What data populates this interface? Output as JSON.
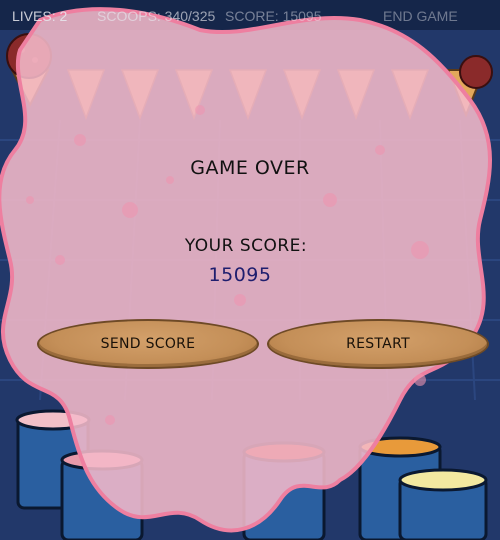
{
  "hud": {
    "lives": "LIVES: 2",
    "scoops": "SCOOPS: 340/325",
    "score": "SCORE: 15095",
    "end_game": "END GAME"
  },
  "game_over": {
    "title": "GAME OVER",
    "score_label": "YOUR SCORE:",
    "score_value": "15095"
  },
  "buttons": {
    "send_score": "SEND SCORE",
    "restart": "RESTART"
  },
  "colors": {
    "splat_pink": "#f7b8c8",
    "background_blue": "#1a2f5c",
    "button_tan": "#c48f58"
  }
}
